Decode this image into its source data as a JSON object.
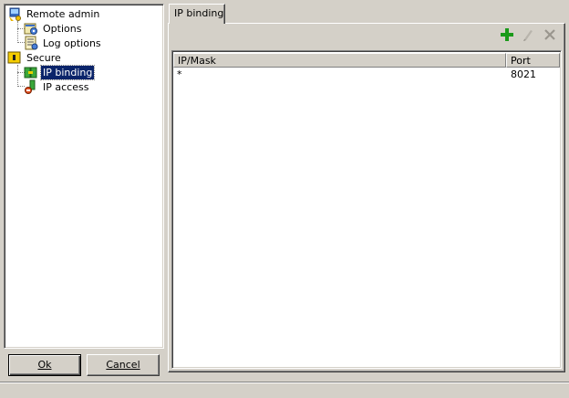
{
  "tree": {
    "items": [
      {
        "label": "Remote admin",
        "icon": "remote-admin-icon"
      },
      {
        "label": "Options",
        "icon": "options-icon"
      },
      {
        "label": "Log options",
        "icon": "log-options-icon"
      },
      {
        "label": "Secure",
        "icon": "secure-icon"
      },
      {
        "label": "IP binding",
        "icon": "ip-binding-icon",
        "selected": true
      },
      {
        "label": "IP access",
        "icon": "ip-access-icon"
      }
    ]
  },
  "buttons": {
    "ok_label": "Ok",
    "cancel_label": "Cancel"
  },
  "tab": {
    "label": "IP binding"
  },
  "toolbar": {
    "add_icon": "add-icon",
    "edit_icon": "edit-icon",
    "delete_icon": "delete-icon"
  },
  "grid": {
    "columns": [
      "IP/Mask",
      "Port"
    ],
    "rows": [
      {
        "ip_mask": "*",
        "port": "8021"
      }
    ]
  },
  "colors": {
    "selection": "#0a246a",
    "add_green": "#1a9a1a",
    "face": "#d4d0c8"
  }
}
